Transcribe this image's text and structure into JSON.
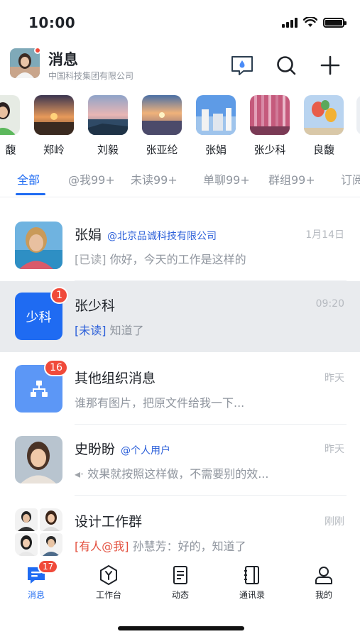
{
  "status_bar": {
    "time": "10:00"
  },
  "header": {
    "title": "消息",
    "subtitle": "中国科技集团有限公司",
    "actions": [
      "chat-bubble-icon",
      "search-icon",
      "plus-icon"
    ]
  },
  "contacts": [
    {
      "name": "馥"
    },
    {
      "name": "郑岭"
    },
    {
      "name": "刘毅"
    },
    {
      "name": "张亚纶"
    },
    {
      "name": "张娟"
    },
    {
      "name": "张少科"
    },
    {
      "name": "良馥"
    }
  ],
  "tabs": [
    {
      "label": "全部",
      "active": true
    },
    {
      "label": "@我99+",
      "active": false
    },
    {
      "label": "未读99+",
      "active": false
    },
    {
      "label": "单聊99+",
      "active": false
    },
    {
      "label": "群组99+",
      "active": false
    },
    {
      "label": "订阅",
      "active": false
    }
  ],
  "messages": [
    {
      "name": "张娟",
      "org": "@北京品诚科技有限公司",
      "time": "1月14日",
      "tag": "[已读]",
      "preview": "你好，今天的工作是这样的"
    },
    {
      "name": "张少科",
      "avatar_text": "少科",
      "badge": "1",
      "time": "09:20",
      "tag": "[未读]",
      "preview": "知道了"
    },
    {
      "name": "其他组织消息",
      "badge": "16",
      "time": "昨天",
      "preview": "谁那有图片，把原文件给我一下..."
    },
    {
      "name": "史盼盼",
      "org": "@个人用户",
      "time": "昨天",
      "tag": "◂·",
      "preview": "效果就按照这样做，不需要别的效..."
    },
    {
      "name": "设计工作群",
      "time": "刚刚",
      "tag": "[有人@我]",
      "preview": "孙慧芳：好的，知道了"
    }
  ],
  "tabbar": [
    {
      "label": "消息",
      "icon": "message-icon",
      "badge": "17",
      "active": true
    },
    {
      "label": "工作台",
      "icon": "workbench-icon",
      "active": false
    },
    {
      "label": "动态",
      "icon": "feed-icon",
      "active": false
    },
    {
      "label": "通讯录",
      "icon": "contacts-book-icon",
      "active": false
    },
    {
      "label": "我的",
      "icon": "profile-icon",
      "active": false
    }
  ],
  "colors": {
    "accent": "#1f6bf2",
    "badge": "#f04a3a",
    "selected_row": "#e9ebee"
  }
}
